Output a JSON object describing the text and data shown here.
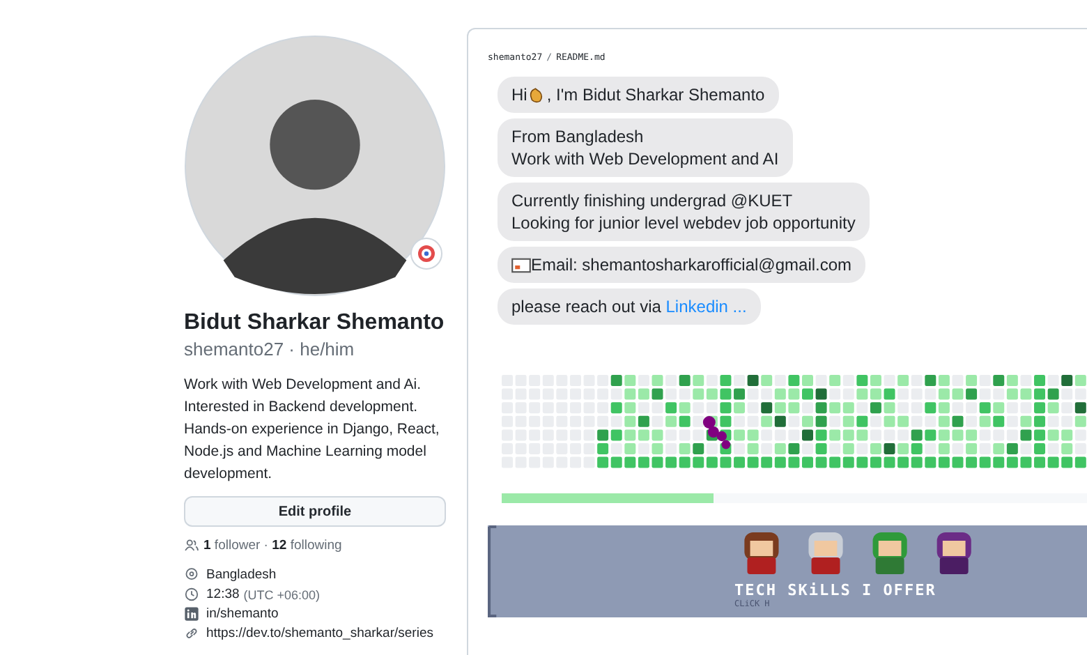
{
  "profile": {
    "name": "Bidut Sharkar Shemanto",
    "handle": "shemanto27 · he/him",
    "bio": "Work with Web Development and Ai. Interested in Backend development. Hands-on experience in Django, React, Node.js and Machine Learning model development.",
    "edit_button": "Edit profile",
    "follow": "**1** follower · **12** following",
    "details": [
      {
        "kind": "location",
        "text": "Bangladesh"
      },
      {
        "kind": "time",
        "text": "12:38",
        "note": "(UTC +06:00)"
      },
      {
        "kind": "linkedin",
        "text": "in/shemanto"
      },
      {
        "kind": "link",
        "text": "https://dev.to/shemanto_sharkar/series"
      }
    ]
  },
  "readme": {
    "path": "shemanto27",
    "separator": "/",
    "file": "README.md",
    "snake_progress": {
      "level": 0.36
    },
    "bubbles": [
      {
        "kind": "greeting",
        "lines": [
          "Hi",
          ", I'm Bidut Sharkar Shemanto"
        ]
      },
      {
        "kind": "text",
        "lines": [
          "From Bangladesh",
          "Work with Web Development and AI"
        ]
      },
      {
        "kind": "text",
        "lines": [
          "Currently finishing undergrad @KUET",
          "Looking for junior level webdev job opportunity"
        ]
      },
      {
        "kind": "email",
        "lines": [
          "Email: shemantosharkarofficial@gmail.com"
        ]
      },
      {
        "kind": "link",
        "lines": [
          "please reach out via",
          "Linkedin ..."
        ]
      }
    ],
    "banner": {
      "title": "TECH SKiLLS I OFFER",
      "hint": "CLiCK H"
    }
  }
}
